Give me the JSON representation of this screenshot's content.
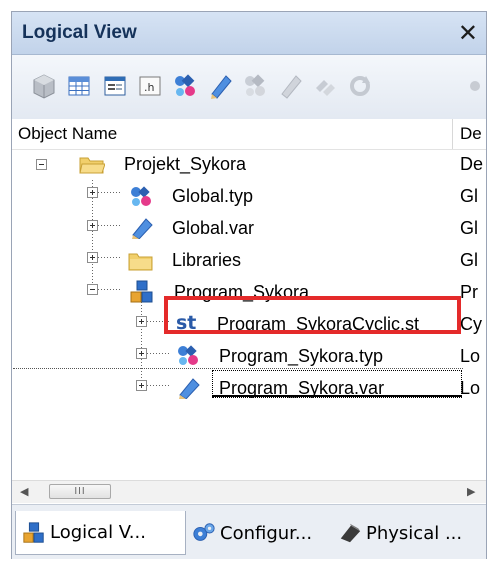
{
  "panel": {
    "title": "Logical View",
    "close_glyph": "✕"
  },
  "toolbar": {
    "icons": [
      "cube-icon",
      "table-icon",
      "form-icon",
      "h-file-icon",
      "typ-icon",
      "var-icon",
      "typ-disabled-icon",
      "var-disabled-icon",
      "links-disabled-icon",
      "refresh-disabled-icon",
      "more-icon"
    ],
    "h_label": ".h"
  },
  "columns": {
    "name": "Object Name",
    "desc": "De"
  },
  "tree": [
    {
      "label": "Projekt_Sykora",
      "desc": "De",
      "icon": "folder-icon"
    },
    {
      "label": "Global.typ",
      "desc": "Gl",
      "icon": "typ-file-icon"
    },
    {
      "label": "Global.var",
      "desc": "Gl",
      "icon": "var-file-icon"
    },
    {
      "label": "Libraries",
      "desc": "Gl",
      "icon": "folder-icon"
    },
    {
      "label": "Program_Sykora",
      "desc": "Pr",
      "icon": "program-icon"
    },
    {
      "label": "Program_SykoraCyclic.st",
      "desc": "Cy",
      "icon": "st-file-icon",
      "icon_text": "st"
    },
    {
      "label": "Program_Sykora.typ",
      "desc": "Lo",
      "icon": "typ-file-icon"
    },
    {
      "label": "Program_Sykora.var",
      "desc": "Lo",
      "icon": "var-file-icon"
    }
  ],
  "scrollbar": {
    "left": "◀",
    "right": "▶",
    "grip": "III"
  },
  "tabs": [
    {
      "label": "Logical V...",
      "icon": "logical-view-icon",
      "active": true
    },
    {
      "label": "Configur...",
      "icon": "configuration-icon",
      "active": false
    },
    {
      "label": "Physical ...",
      "icon": "physical-view-icon",
      "active": false
    }
  ],
  "colors": {
    "highlight": "#e42a2a",
    "title_bg": "#c9d9ee",
    "selection": "#000000"
  }
}
